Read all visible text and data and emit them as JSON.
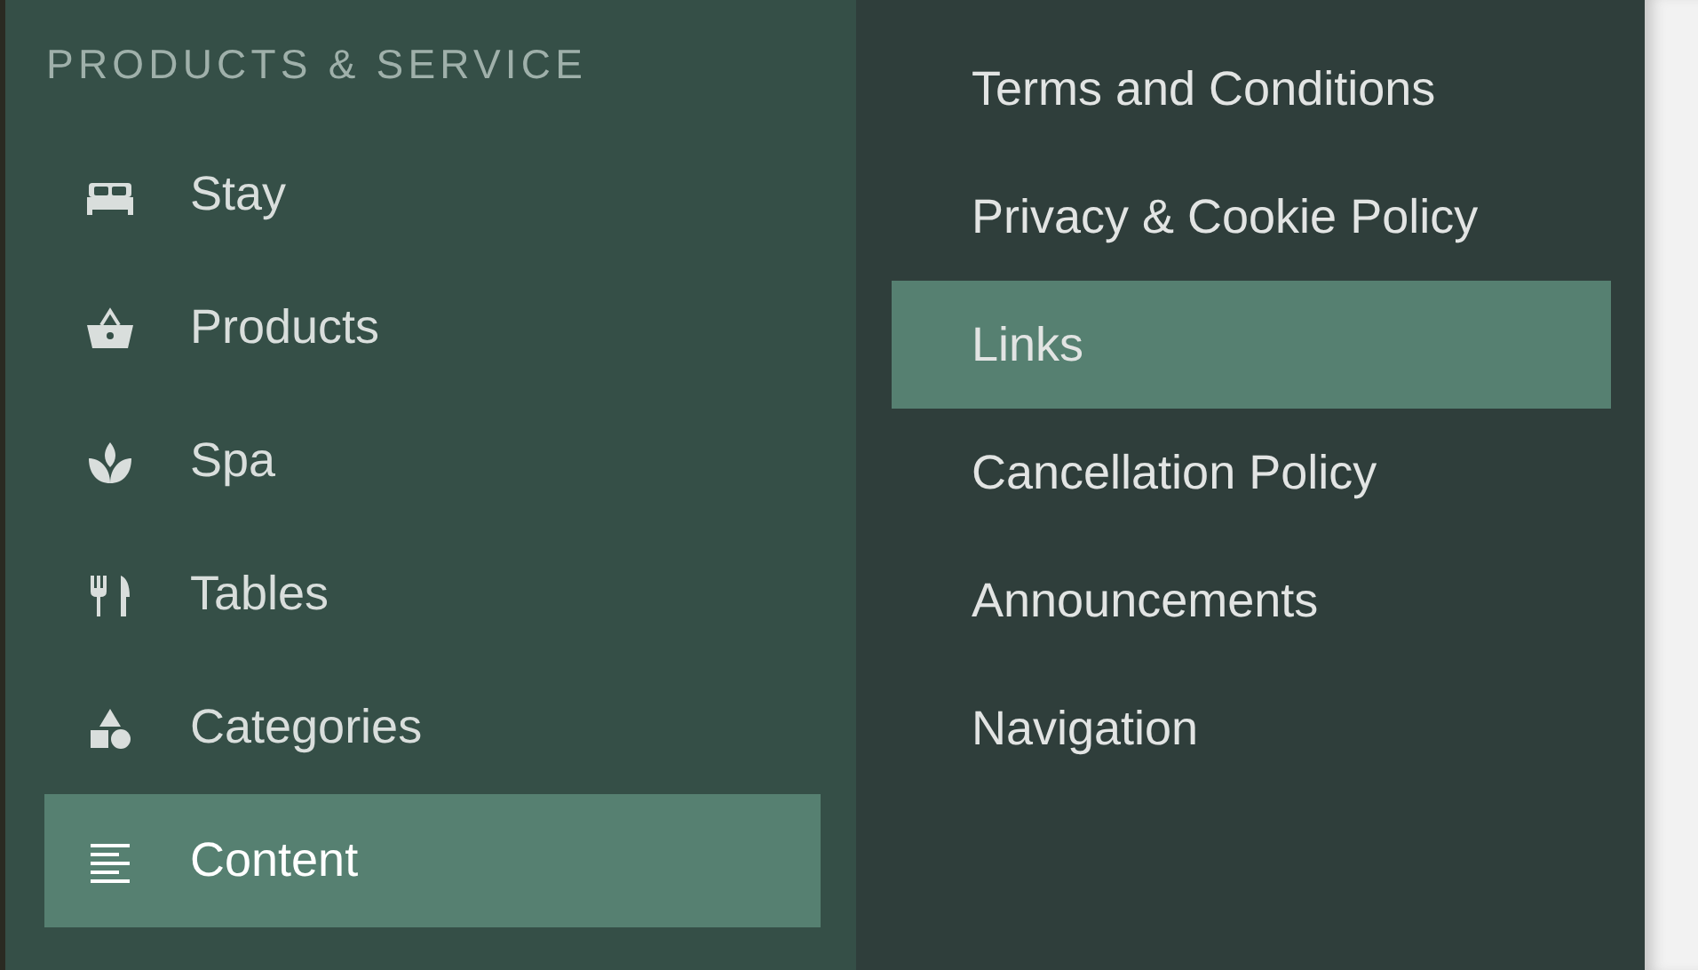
{
  "sidebar": {
    "heading": "PRODUCTS & SERVICE",
    "items": [
      {
        "label": "Stay",
        "selected": false
      },
      {
        "label": "Products",
        "selected": false
      },
      {
        "label": "Spa",
        "selected": false
      },
      {
        "label": "Tables",
        "selected": false
      },
      {
        "label": "Categories",
        "selected": false
      },
      {
        "label": "Content",
        "selected": true
      }
    ]
  },
  "submenu": {
    "items": [
      {
        "label": "Terms and Conditions",
        "selected": false
      },
      {
        "label": "Privacy & Cookie Policy",
        "selected": false
      },
      {
        "label": "Links",
        "selected": true
      },
      {
        "label": "Cancellation Policy",
        "selected": false
      },
      {
        "label": "Announcements",
        "selected": false
      },
      {
        "label": "Navigation",
        "selected": false
      }
    ]
  }
}
